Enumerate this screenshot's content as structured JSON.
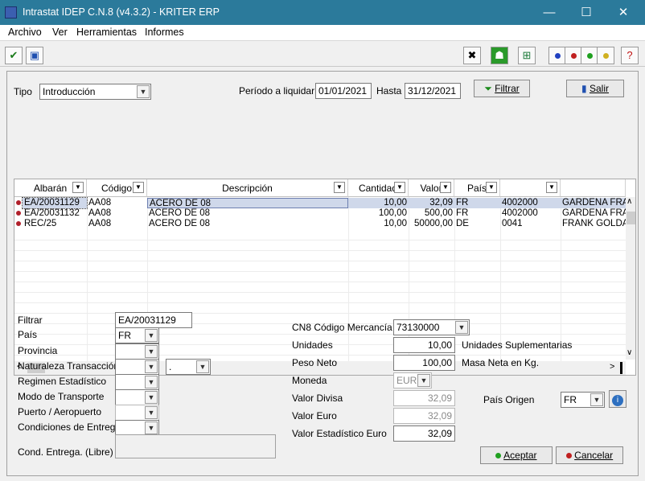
{
  "window": {
    "title": "Intrastat IDEP C.N.8 (v4.3.2) - KRITER ERP",
    "minimize": "—",
    "maximize": "☐",
    "close": "✕"
  },
  "menu": [
    "Archivo",
    "Ver",
    "Herramientas",
    "Informes"
  ],
  "toolbar": {
    "save_icon_glyph": "💾",
    "check_icon_glyph": "✔"
  },
  "filters": {
    "tipo_label": "Tipo",
    "tipo_value": "Introducción",
    "periodo_label": "Período a liquidar",
    "desde": "01/01/2021",
    "hasta_label": "Hasta",
    "hasta": "31/12/2021",
    "filtrar_button": "Filtrar",
    "salir_button": "Salir"
  },
  "grid": {
    "headers": [
      "Albarán",
      "Código",
      "Descripción",
      "Cantidad",
      "Valor",
      "País",
      "",
      ""
    ],
    "rows": [
      [
        "EA/20031129",
        "AA08",
        "ACERO DE 08",
        "10,00",
        "32,09",
        "FR",
        "4002000",
        "GARDENA FRA"
      ],
      [
        "EA/20031132",
        "AA08",
        "ACERO DE 08",
        "100,00",
        "500,00",
        "FR",
        "4002000",
        "GARDENA FRA"
      ],
      [
        "REC/25",
        "AA08",
        "ACERO DE 08",
        "10,00",
        "50000,00",
        "DE",
        "0041",
        "FRANK GOLDA"
      ]
    ]
  },
  "detail": {
    "filtrar_label": "Filtrar",
    "filtrar_value": "EA/20031129",
    "pais_label": "País",
    "pais_value": "FR",
    "provincia_label": "Provincia",
    "naturaleza_label": "Naturaleza Transacción",
    "naturaleza_sub": ".",
    "regimen_label": "Regimen Estadístico",
    "modo_label": "Modo de Transporte",
    "puerto_label": "Puerto / Aeropuerto",
    "condiciones_label": "Condiciones de Entrega",
    "cond_libre_label": "Cond. Entrega. (Libre)",
    "cn8_label": "CN8 Código Mercancía",
    "cn8_value": "73130000",
    "unidades_label": "Unidades",
    "unidades_value": "10,00",
    "unidades_sup": "Unidades Suplementarias",
    "peso_label": "Peso Neto",
    "peso_value": "100,00",
    "peso_sup": "Masa Neta en Kg.",
    "moneda_label": "Moneda",
    "moneda_value": "EUR",
    "divisa_label": "Valor Divisa",
    "divisa_value": "32,09",
    "euro_label": "Valor Euro",
    "euro_value": "32,09",
    "estadistico_label": "Valor Estadístico Euro",
    "estadistico_value": "32,09",
    "pais_origen_label": "País Origen",
    "pais_origen_value": "FR",
    "aceptar_button": "Aceptar",
    "cancelar_button": "Cancelar"
  }
}
